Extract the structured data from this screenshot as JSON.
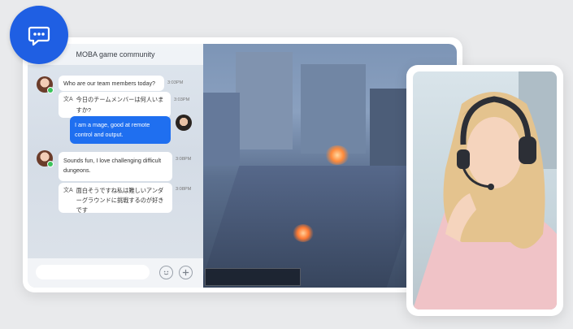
{
  "chat": {
    "title": "MOBA game community",
    "messages": [
      {
        "text": "Who are our team members today?",
        "time": "3:03PM"
      },
      {
        "text": "今日のチームメンバーは何人いますか?",
        "time": "3:03PM"
      },
      {
        "text": "I am a mage, good at remote control and output."
      },
      {
        "text": "Sounds fun, I love challenging difficult dungeons.",
        "time": "3:08PM"
      },
      {
        "text": "面白そうですね私は難しいアンダーグラウンドに挑戦するのが好きです",
        "time": "3:08PM"
      }
    ],
    "input_placeholder": ""
  },
  "icons": {
    "badge": "chat-bubble-icon",
    "translate": "translate-icon",
    "emoji": "emoji-icon",
    "add": "add-icon"
  },
  "colors": {
    "accent": "#1f5fe3",
    "outgoing_bubble": "#1f6ff0",
    "online": "#3cc35b"
  }
}
